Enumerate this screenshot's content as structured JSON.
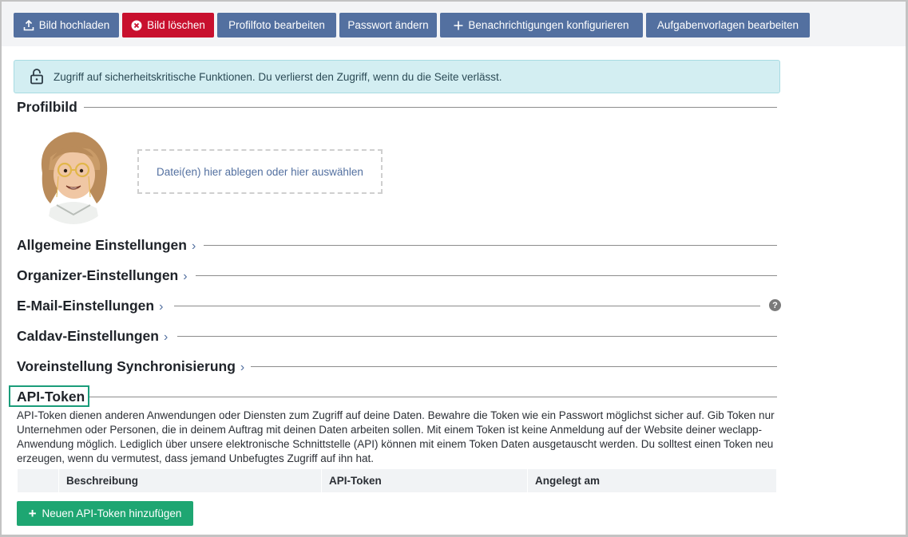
{
  "toolbar": {
    "buttons": [
      {
        "label": "Bild hochladen",
        "icon": "upload-icon",
        "style": "blue"
      },
      {
        "label": "Bild löschen",
        "icon": "delete-circle-icon",
        "style": "red"
      },
      {
        "label": "Profilfoto bearbeiten",
        "style": "blue"
      },
      {
        "label": "Passwort ändern",
        "style": "blue"
      },
      {
        "label": "Benachrichtigungen konfigurieren",
        "icon": "plus-icon",
        "style": "blue"
      },
      {
        "label": "Aufgabenvorlagen bearbeiten",
        "style": "blue"
      }
    ]
  },
  "notice": {
    "icon": "lock-open-icon",
    "text": "Zugriff auf sicherheitskritische Funktionen. Du verlierst den Zugriff, wenn du die Seite verlässt."
  },
  "profile": {
    "title": "Profilbild",
    "dropzone": "Datei(en) hier ablegen oder hier auswählen"
  },
  "sections": [
    {
      "title": "Allgemeine Einstellungen",
      "chevron": "›"
    },
    {
      "title": "Organizer-Einstellungen",
      "chevron": "›"
    },
    {
      "title": "E-Mail-Einstellungen",
      "chevron": "›",
      "help": "?"
    },
    {
      "title": "Caldav-Einstellungen",
      "chevron": "›"
    },
    {
      "title": "Voreinstellung Synchronisierung",
      "chevron": "›"
    }
  ],
  "api_token": {
    "title": "API-Token",
    "description": "API-Token dienen anderen Anwendungen oder Diensten zum Zugriff auf deine Daten. Bewahre die Token wie ein Passwort möglichst sicher auf. Gib Token nur Unternehmen oder Personen, die in deinem Auftrag mit deinen Daten arbeiten sollen. Mit einem Token ist keine Anmeldung auf der Website deiner weclapp-Anwendung möglich. Lediglich über unsere elektronische Schnittstelle (API) können mit einem Token Daten ausgetauscht werden. Du solltest einen Token neu erzeugen, wenn du vermutest, dass jemand Unbefugtes Zugriff auf ihn hat.",
    "columns": [
      "",
      "Beschreibung",
      "API-Token",
      "Angelegt am"
    ],
    "add_button": "Neuen API-Token hinzufügen",
    "add_icon": "plus-icon"
  },
  "colors": {
    "primary": "#5370a0",
    "danger": "#c8102e",
    "success": "#1ea672",
    "info_bg": "#d3eef2",
    "focus": "#1a9c7a"
  }
}
